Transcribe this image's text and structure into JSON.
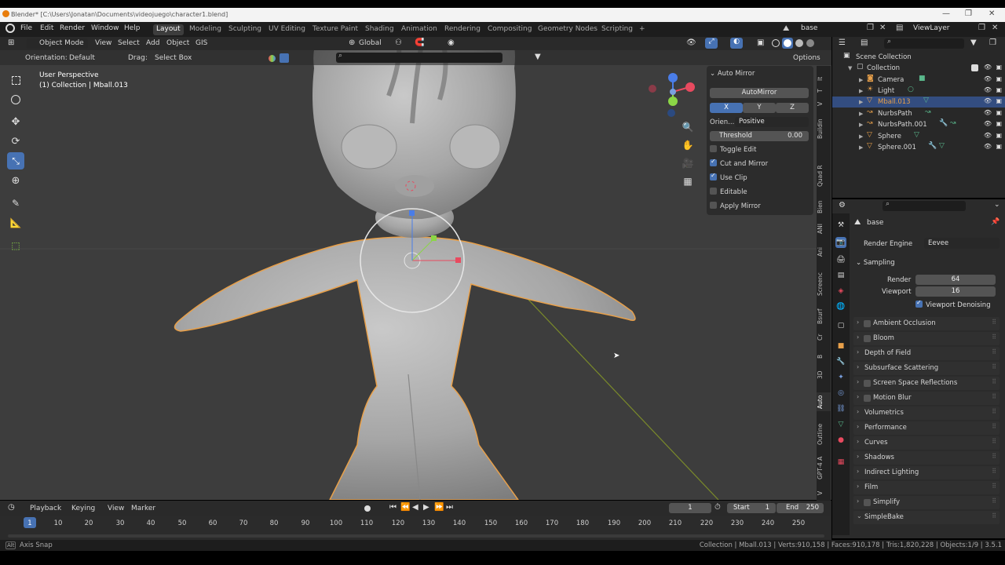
{
  "window": {
    "title": "Blender* [C:\\Users\\Jonatan\\Documents\\videojuego\\character1.blend]"
  },
  "topbar": {
    "menus": [
      "File",
      "Edit",
      "Render",
      "Window",
      "Help"
    ],
    "workspaces": [
      "Layout",
      "Modeling",
      "Sculpting",
      "UV Editing",
      "Texture Paint",
      "Shading",
      "Animation",
      "Rendering",
      "Compositing",
      "Geometry Nodes",
      "Scripting"
    ],
    "active_workspace": "Layout",
    "add_tab": "+",
    "scene_name": "base",
    "view_layer": "ViewLayer"
  },
  "viewport_header": {
    "mode": "Object Mode",
    "menus": [
      "View",
      "Select",
      "Add",
      "Object",
      "GIS"
    ],
    "transform_orientation": "Global",
    "orientation_label": "Orientation:",
    "orientation_value": "Default",
    "drag_label": "Drag:",
    "drag_value": "Select Box",
    "options_label": "Options"
  },
  "viewport": {
    "perspective_label": "User Perspective",
    "collection_label": "(1) Collection | Mball.013",
    "accent_active": "#4772b3",
    "selection_outline": "#e8a04a"
  },
  "auto_mirror_panel": {
    "title": "Auto Mirror",
    "button": "AutoMirror",
    "axes": [
      "X",
      "Y",
      "Z"
    ],
    "active_axis": "X",
    "orientation_label": "Orien...",
    "orientation_value": "Positive",
    "threshold_label": "Threshold",
    "threshold_value": "0.00",
    "options": [
      {
        "label": "Toggle Edit",
        "checked": false
      },
      {
        "label": "Cut and Mirror",
        "checked": true
      },
      {
        "label": "Use Clip",
        "checked": true
      },
      {
        "label": "Editable",
        "checked": false
      },
      {
        "label": "Apply Mirror",
        "checked": false
      }
    ]
  },
  "side_tabs": [
    "It",
    "T",
    "V",
    "Buildin",
    "Quad R",
    "Bien",
    "ANI",
    "Ani",
    "Screenc",
    "Bsurf",
    "Cr",
    "B",
    "3D",
    "Auto",
    "Outline",
    "GPT-4 A",
    "V"
  ],
  "outliner": {
    "root": "Scene Collection",
    "collection": "Collection",
    "items": [
      {
        "name": "Camera",
        "selected": false
      },
      {
        "name": "Light",
        "selected": false
      },
      {
        "name": "Mball.013",
        "selected": true
      },
      {
        "name": "NurbsPath",
        "selected": false
      },
      {
        "name": "NurbsPath.001",
        "selected": false
      },
      {
        "name": "Sphere",
        "selected": false
      },
      {
        "name": "Sphere.001",
        "selected": false
      }
    ]
  },
  "properties": {
    "scene_name": "base",
    "render_engine_label": "Render Engine",
    "render_engine_value": "Eevee",
    "sampling": {
      "title": "Sampling",
      "render_label": "Render",
      "render_value": "64",
      "viewport_label": "Viewport",
      "viewport_value": "16",
      "denoise_label": "Viewport Denoising"
    },
    "panels": [
      {
        "label": "Ambient Occlusion",
        "checkbox": true
      },
      {
        "label": "Bloom",
        "checkbox": true
      },
      {
        "label": "Depth of Field",
        "checkbox": false
      },
      {
        "label": "Subsurface Scattering",
        "checkbox": false
      },
      {
        "label": "Screen Space Reflections",
        "checkbox": true
      },
      {
        "label": "Motion Blur",
        "checkbox": true
      },
      {
        "label": "Volumetrics",
        "checkbox": false
      },
      {
        "label": "Performance",
        "checkbox": false
      },
      {
        "label": "Curves",
        "checkbox": false
      },
      {
        "label": "Shadows",
        "checkbox": false
      },
      {
        "label": "Indirect Lighting",
        "checkbox": false
      },
      {
        "label": "Film",
        "checkbox": false
      },
      {
        "label": "Simplify",
        "checkbox": true
      },
      {
        "label": "SimpleBake",
        "checkbox": false,
        "open": true
      }
    ]
  },
  "timeline": {
    "menus": [
      "Playback",
      "Keying",
      "View",
      "Marker"
    ],
    "current_frame": "1",
    "start_label": "Start",
    "start_value": "1",
    "end_label": "End",
    "end_value": "250",
    "ticks": [
      "1",
      "10",
      "20",
      "30",
      "40",
      "50",
      "60",
      "70",
      "80",
      "90",
      "100",
      "110",
      "120",
      "130",
      "140",
      "150",
      "160",
      "170",
      "180",
      "190",
      "200",
      "210",
      "220",
      "230",
      "240",
      "250"
    ]
  },
  "statusbar": {
    "left": "Axis Snap",
    "right": "Collection | Mball.013 | Verts:910,158 | Faces:910,178 | Tris:1,820,228 | Objects:1/9 | 3.5.1"
  }
}
